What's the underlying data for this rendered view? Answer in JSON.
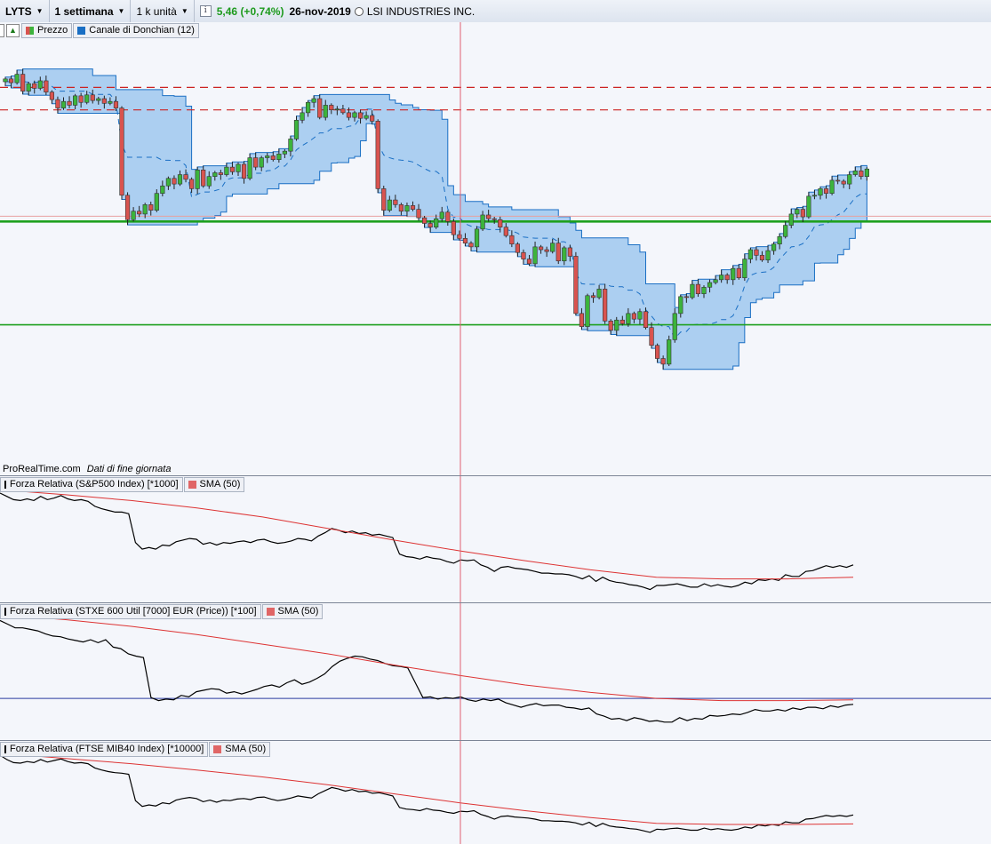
{
  "toolbar": {
    "symbol": "LYTS",
    "period": "1 settimana",
    "units": "1 k unità",
    "info_icon": "i",
    "change": "5,46 (+0,74%)",
    "date": "26-nov-2019",
    "company": "LSI INDUSTRIES INC."
  },
  "price_panel": {
    "legend": {
      "price": "Prezzo",
      "donchian": "Canale di Donchian (12)"
    },
    "source": {
      "site": "ProRealTime.com",
      "note": "Dati di fine giornata"
    }
  },
  "rs_panels": [
    {
      "label": "Forza Relativa (S&P500 Index) [*1000]",
      "sma": "SMA (50)"
    },
    {
      "label": "Forza Relativa (STXE 600 Util [7000] EUR (Price)) [*100]",
      "sma": "SMA (50)"
    },
    {
      "label": "Forza Relativa (FTSE MIB40 Index) [*10000]",
      "sma": "SMA (50)"
    }
  ],
  "colors": {
    "up": "#3cb43c",
    "down": "#d9534f",
    "channel_fill": "#9fc8ee",
    "channel_line": "#1a6fc4",
    "support": "#1ea01e",
    "resistance": "#cc2222",
    "rs_line": "#000000",
    "sma_line": "#dd3333",
    "cursor": "#e06070"
  },
  "chart_data": [
    {
      "type": "candlestick",
      "title": "LYTS",
      "close_series": [
        5.62,
        5.58,
        5.67,
        5.49,
        5.57,
        5.52,
        5.6,
        5.48,
        5.4,
        5.31,
        5.38,
        5.34,
        5.44,
        5.37,
        5.45,
        5.39,
        5.41,
        5.36,
        5.38,
        5.31,
        4.38,
        4.12,
        4.21,
        4.18,
        4.28,
        4.22,
        4.4,
        4.48,
        4.56,
        4.5,
        4.6,
        4.55,
        4.45,
        4.65,
        4.48,
        4.58,
        4.62,
        4.6,
        4.68,
        4.63,
        4.71,
        4.56,
        4.78,
        4.68,
        4.78,
        4.8,
        4.76,
        4.82,
        4.85,
        4.98,
        5.18,
        5.26,
        5.37,
        5.41,
        5.21,
        5.34,
        5.29,
        5.3,
        5.26,
        5.21,
        5.26,
        5.2,
        5.23,
        5.17,
        4.45,
        4.22,
        4.33,
        4.28,
        4.21,
        4.27,
        4.23,
        4.14,
        4.08,
        4.04,
        4.13,
        4.2,
        4.1,
        3.96,
        3.92,
        3.87,
        3.83,
        4.02,
        4.17,
        4.13,
        4.12,
        4.04,
        3.95,
        3.86,
        3.77,
        3.7,
        3.65,
        3.83,
        3.8,
        3.78,
        3.87,
        3.68,
        3.82,
        3.73,
        3.12,
        2.98,
        3.31,
        3.29,
        3.38,
        3.04,
        2.94,
        3.05,
        3.01,
        3.12,
        3.06,
        3.14,
        2.97,
        2.78,
        2.64,
        2.58,
        2.84,
        3.12,
        3.3,
        3.29,
        3.43,
        3.33,
        3.4,
        3.45,
        3.48,
        3.53,
        3.48,
        3.6,
        3.5,
        3.7,
        3.8,
        3.74,
        3.69,
        3.79,
        3.86,
        3.94,
        4.06,
        4.18,
        4.23,
        4.15,
        4.37,
        4.38,
        4.45,
        4.4,
        4.54,
        4.53,
        4.5,
        4.6,
        4.64,
        4.58,
        4.66
      ],
      "donchian_period": 12,
      "horizontal_levels": {
        "support": [
          4.1,
          3.0
        ],
        "resistance": [
          5.53,
          5.29
        ]
      }
    },
    {
      "type": "line",
      "title": "Forza Relativa (S&P500 Index) [*1000]",
      "series": [
        {
          "name": "Forza Relativa (S&P500 Index) [*1000]",
          "values": [
            1.81,
            1.77,
            1.73,
            1.72,
            1.74,
            1.72,
            1.77,
            1.73,
            1.75,
            1.78,
            1.74,
            1.72,
            1.73,
            1.71,
            1.65,
            1.62,
            1.6,
            1.58,
            1.58,
            1.56,
            1.21,
            1.13,
            1.15,
            1.13,
            1.18,
            1.17,
            1.22,
            1.24,
            1.26,
            1.25,
            1.19,
            1.21,
            1.18,
            1.21,
            1.2,
            1.22,
            1.23,
            1.21,
            1.24,
            1.25,
            1.22,
            1.2,
            1.21,
            1.23,
            1.26,
            1.25,
            1.23,
            1.29,
            1.33,
            1.38,
            1.36,
            1.33,
            1.35,
            1.32,
            1.33,
            1.3,
            1.31,
            1.29,
            1.27,
            1.07,
            1.04,
            1.03,
            1.01,
            1.04,
            1.02,
            1.01,
            0.98,
            0.96,
            1.0,
            0.99,
            1.0,
            0.94,
            0.91,
            0.86,
            0.91,
            0.92,
            0.9,
            0.89,
            0.88,
            0.86,
            0.84,
            0.84,
            0.83,
            0.83,
            0.82,
            0.8,
            0.77,
            0.81,
            0.74,
            0.79,
            0.75,
            0.73,
            0.72,
            0.7,
            0.69,
            0.67,
            0.64,
            0.69,
            0.69,
            0.7,
            0.71,
            0.69,
            0.67,
            0.67,
            0.71,
            0.68,
            0.7,
            0.68,
            0.67,
            0.69,
            0.73,
            0.71,
            0.76,
            0.75,
            0.77,
            0.75,
            0.82,
            0.8,
            0.8,
            0.86,
            0.87,
            0.9,
            0.93,
            0.91,
            0.93,
            0.91,
            0.94
          ]
        },
        {
          "name": "SMA (50)",
          "values": [
            1.85,
            1.79,
            1.72,
            1.63,
            1.52,
            1.38,
            1.24,
            1.11,
            0.99,
            0.88,
            0.79,
            0.77,
            0.77,
            0.79
          ]
        }
      ]
    },
    {
      "type": "line",
      "title": "Forza Relativa (STXE 600 Util [7000] EUR (Price)) [*100]",
      "series": [
        {
          "name": "Forza Relativa (STXE 600 Util [7000] EUR (Price)) [*100]",
          "values": [
            1.84,
            1.79,
            1.74,
            1.74,
            1.72,
            1.7,
            1.66,
            1.63,
            1.62,
            1.59,
            1.57,
            1.55,
            1.58,
            1.54,
            1.58,
            1.48,
            1.46,
            1.39,
            1.36,
            1.34,
            0.8,
            0.76,
            0.78,
            0.77,
            0.83,
            0.81,
            0.88,
            0.9,
            0.92,
            0.91,
            0.86,
            0.88,
            0.85,
            0.88,
            0.91,
            0.95,
            0.97,
            0.94,
            1.0,
            1.04,
            0.98,
            1.01,
            1.06,
            1.12,
            1.22,
            1.29,
            1.33,
            1.36,
            1.35,
            1.32,
            1.3,
            1.26,
            1.23,
            1.22,
            1.2,
            1.0,
            0.8,
            0.81,
            0.78,
            0.8,
            0.79,
            0.81,
            0.77,
            0.75,
            0.78,
            0.76,
            0.78,
            0.73,
            0.7,
            0.67,
            0.7,
            0.72,
            0.69,
            0.7,
            0.7,
            0.67,
            0.66,
            0.64,
            0.66,
            0.58,
            0.55,
            0.51,
            0.52,
            0.49,
            0.53,
            0.51,
            0.48,
            0.49,
            0.47,
            0.47,
            0.53,
            0.49,
            0.52,
            0.51,
            0.56,
            0.55,
            0.56,
            0.58,
            0.57,
            0.6,
            0.64,
            0.62,
            0.62,
            0.64,
            0.62,
            0.66,
            0.64,
            0.67,
            0.67,
            0.65,
            0.69,
            0.67,
            0.7,
            0.71
          ]
        },
        {
          "name": "SMA (50)",
          "values": [
            1.92,
            1.85,
            1.76,
            1.65,
            1.52,
            1.39,
            1.24,
            1.1,
            0.97,
            0.87,
            0.79,
            0.76,
            0.76,
            0.77
          ]
        }
      ],
      "reference_line": 0.79
    },
    {
      "type": "line",
      "title": "Forza Relativa (FTSE MIB40 Index) [*10000]",
      "series": [
        {
          "name": "Forza Relativa (FTSE MIB40 Index) [*10000]",
          "values": [
            2.18,
            2.1,
            2.04,
            2.03,
            2.06,
            2.04,
            2.1,
            2.05,
            2.08,
            2.11,
            2.06,
            2.03,
            2.04,
            2.02,
            1.94,
            1.9,
            1.87,
            1.85,
            1.84,
            1.82,
            1.32,
            1.21,
            1.24,
            1.22,
            1.28,
            1.26,
            1.33,
            1.36,
            1.38,
            1.36,
            1.3,
            1.33,
            1.29,
            1.33,
            1.32,
            1.35,
            1.36,
            1.34,
            1.38,
            1.39,
            1.35,
            1.32,
            1.34,
            1.37,
            1.41,
            1.39,
            1.37,
            1.45,
            1.51,
            1.57,
            1.54,
            1.5,
            1.53,
            1.49,
            1.5,
            1.46,
            1.47,
            1.44,
            1.41,
            1.19,
            1.16,
            1.15,
            1.13,
            1.17,
            1.14,
            1.13,
            1.1,
            1.08,
            1.12,
            1.11,
            1.13,
            1.06,
            1.02,
            0.97,
            1.02,
            1.03,
            1.01,
            1.0,
            0.99,
            0.97,
            0.94,
            0.94,
            0.93,
            0.93,
            0.92,
            0.9,
            0.86,
            0.91,
            0.83,
            0.89,
            0.84,
            0.82,
            0.81,
            0.79,
            0.78,
            0.75,
            0.72,
            0.78,
            0.77,
            0.79,
            0.8,
            0.78,
            0.76,
            0.76,
            0.8,
            0.77,
            0.79,
            0.77,
            0.76,
            0.78,
            0.82,
            0.8,
            0.86,
            0.84,
            0.87,
            0.85,
            0.92,
            0.9,
            0.9,
            0.97,
            0.98,
            1.01,
            1.04,
            1.02,
            1.04,
            1.02,
            1.05
          ]
        },
        {
          "name": "SMA (50)",
          "values": [
            2.22,
            2.12,
            2.02,
            1.9,
            1.77,
            1.62,
            1.45,
            1.28,
            1.13,
            1.0,
            0.89,
            0.87,
            0.87,
            0.88
          ]
        }
      ]
    }
  ]
}
